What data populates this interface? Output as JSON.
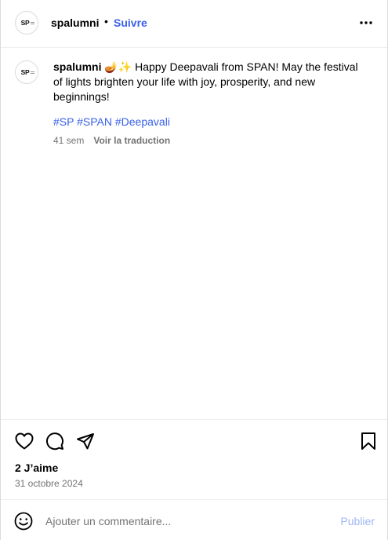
{
  "header": {
    "username": "spalumni",
    "separator": "•",
    "follow_label": "Suivre",
    "avatar_text": "SP",
    "more_icon": "more-horizontal-icon"
  },
  "caption": {
    "username": "spalumni",
    "text": " 🪔✨ Happy Deepavali from SPAN! May the festival of lights brighten your life with joy, prosperity, and new beginnings!",
    "hashtags": [
      "#SP",
      "#SPAN",
      "#Deepavali"
    ],
    "age": "41 sem",
    "translate_label": "Voir la traduction"
  },
  "actions": {
    "icons": [
      "heart-icon",
      "comment-icon",
      "share-icon",
      "bookmark-icon"
    ]
  },
  "likes_label": "2 J’aime",
  "date_label": "31 octobre 2024",
  "comment_bar": {
    "placeholder": "Ajouter un commentaire...",
    "value": "",
    "publish_label": "Publier",
    "emoji_icon": "emoji-icon"
  },
  "colors": {
    "link": "#3a60e8",
    "muted": "#737373",
    "publish_disabled": "#9db6f5",
    "border": "#efefef"
  }
}
